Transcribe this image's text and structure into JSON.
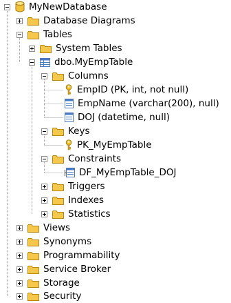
{
  "tree": {
    "database": "MyNewDatabase",
    "database_diagrams": "Database Diagrams",
    "tables": "Tables",
    "system_tables": "System Tables",
    "table": "dbo.MyEmpTable",
    "columns": "Columns",
    "col_empid": "EmpID (PK, int, not null)",
    "col_empname": "EmpName (varchar(200), null)",
    "col_doj": "DOJ (datetime, null)",
    "keys": "Keys",
    "pk": "PK_MyEmpTable",
    "constraints": "Constraints",
    "df": "DF_MyEmpTable_DOJ",
    "triggers": "Triggers",
    "indexes": "Indexes",
    "statistics": "Statistics",
    "views": "Views",
    "synonyms": "Synonyms",
    "programmability": "Programmability",
    "service_broker": "Service Broker",
    "storage": "Storage",
    "security": "Security"
  },
  "icons": {
    "database": "database-icon",
    "folder": "folder-icon",
    "table": "table-icon",
    "key": "key-icon",
    "column": "column-icon",
    "constraint": "constraint-icon"
  },
  "colors": {
    "folder": "#f5c74b",
    "key": "#d4a017",
    "table": "#4a78c2",
    "tree_line": "#a0a0a0"
  }
}
